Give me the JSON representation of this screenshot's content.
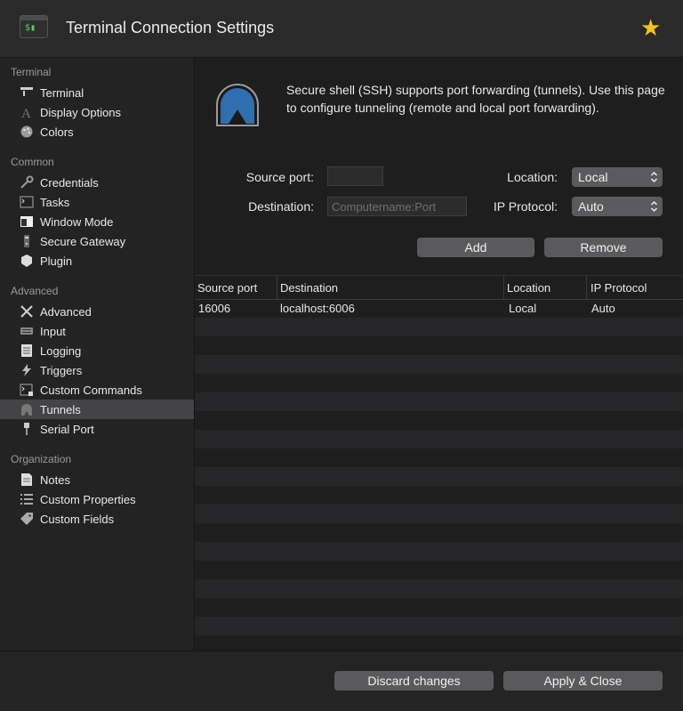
{
  "window": {
    "title": "Terminal Connection Settings",
    "favorite_icon": "star-icon"
  },
  "sidebar": {
    "sections": [
      {
        "title": "Terminal",
        "items": [
          {
            "label": "Terminal",
            "icon": "terminal-icon"
          },
          {
            "label": "Display Options",
            "icon": "font-icon"
          },
          {
            "label": "Colors",
            "icon": "palette-icon"
          }
        ]
      },
      {
        "title": "Common",
        "items": [
          {
            "label": "Credentials",
            "icon": "key-icon"
          },
          {
            "label": "Tasks",
            "icon": "tasks-icon"
          },
          {
            "label": "Window Mode",
            "icon": "window-icon"
          },
          {
            "label": "Secure Gateway",
            "icon": "gateway-icon"
          },
          {
            "label": "Plugin",
            "icon": "plugin-icon"
          }
        ]
      },
      {
        "title": "Advanced",
        "items": [
          {
            "label": "Advanced",
            "icon": "tools-icon"
          },
          {
            "label": "Input",
            "icon": "keyboard-icon"
          },
          {
            "label": "Logging",
            "icon": "log-icon"
          },
          {
            "label": "Triggers",
            "icon": "lightning-icon"
          },
          {
            "label": "Custom Commands",
            "icon": "command-icon"
          },
          {
            "label": "Tunnels",
            "icon": "tunnel-icon",
            "selected": true
          },
          {
            "label": "Serial Port",
            "icon": "serial-port-icon"
          }
        ]
      },
      {
        "title": "Organization",
        "items": [
          {
            "label": "Notes",
            "icon": "notes-icon"
          },
          {
            "label": "Custom Properties",
            "icon": "list-icon"
          },
          {
            "label": "Custom Fields",
            "icon": "tag-icon"
          }
        ]
      }
    ]
  },
  "main": {
    "description": "Secure shell (SSH) supports port forwarding (tunnels). Use this page to configure tunneling (remote and local port forwarding).",
    "form": {
      "source_port_label": "Source port:",
      "source_port_value": "",
      "destination_label": "Destination:",
      "destination_placeholder": "Computername:Port",
      "location_label": "Location:",
      "location_value": "Local",
      "protocol_label": "IP Protocol:",
      "protocol_value": "Auto",
      "add_label": "Add",
      "remove_label": "Remove"
    },
    "table": {
      "columns": [
        "Source port",
        "Destination",
        "Location",
        "IP Protocol"
      ],
      "rows": [
        {
          "source_port": "16006",
          "destination": "localhost:6006",
          "location": "Local",
          "protocol": "Auto"
        }
      ]
    }
  },
  "footer": {
    "discard_label": "Discard changes",
    "apply_label": "Apply & Close"
  },
  "colors": {
    "background": "#1e1e1e",
    "sidebar_selected": "#444446",
    "button": "#5a5a5c",
    "star": "#f5c518",
    "tunnel_icon_blue": "#2f6fb0"
  }
}
